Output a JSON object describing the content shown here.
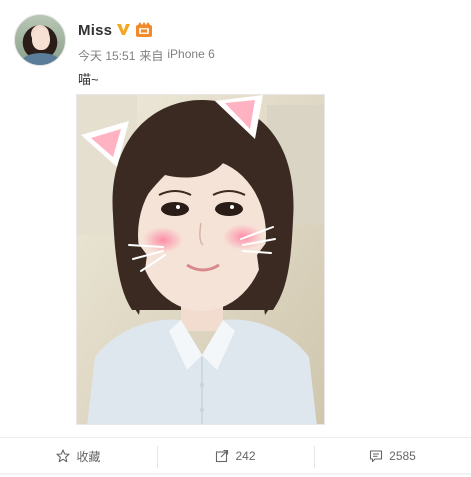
{
  "post": {
    "username": "Miss",
    "time": "今天 15:51",
    "source_prefix": "来自",
    "source": "iPhone 6",
    "text": "喵~"
  },
  "actions": {
    "favorite_label": "收藏",
    "repost_count": "242",
    "comment_count": "2585"
  },
  "icons": {
    "verified": "verified-v-icon",
    "member": "member-crown-icon",
    "favorite": "star-icon",
    "repost": "repost-icon",
    "comment": "comment-icon"
  },
  "colors": {
    "verified": "#f5a623",
    "member": "#f08a2a",
    "text": "#333333",
    "meta": "#808080"
  }
}
